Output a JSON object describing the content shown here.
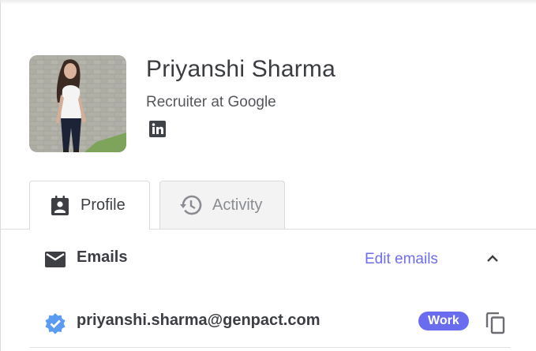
{
  "profile": {
    "name": "Priyanshi Sharma",
    "headline": "Recruiter at Google",
    "avatar_icon": "profile-photo",
    "social_icon": "linkedin-icon"
  },
  "tabs": [
    {
      "label": "Profile",
      "icon": "contact-badge-icon",
      "active": true
    },
    {
      "label": "Activity",
      "icon": "history-icon",
      "active": false
    }
  ],
  "emails_section": {
    "title": "Emails",
    "edit_label": "Edit emails",
    "expanded": true,
    "items": [
      {
        "address": "priyanshi.sharma@genpact.com",
        "type": "Work",
        "verified": true
      }
    ]
  },
  "colors": {
    "accent": "#6e6ef0",
    "badge": "#6a6cf0",
    "verified": "#5b9cf2",
    "text": "#3c3e43"
  }
}
